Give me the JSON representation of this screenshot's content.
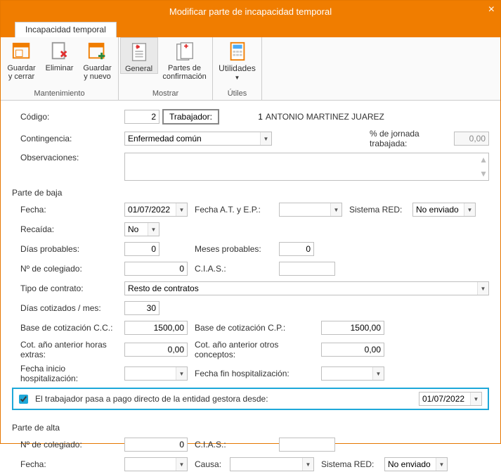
{
  "window": {
    "title": "Modificar parte de incapacidad temporal",
    "close": "×"
  },
  "tabs": {
    "main": "Incapacidad temporal"
  },
  "ribbon": {
    "maintenance_label": "Mantenimiento",
    "show_label": "Mostrar",
    "utils_label": "Útiles",
    "save_close": "Guardar y cerrar",
    "delete": "Eliminar",
    "save_new": "Guardar y nuevo",
    "general": "General",
    "confirm_parts": "Partes de confirmación",
    "utilities": "Utilidades"
  },
  "header": {
    "code_label": "Código:",
    "code_value": "2",
    "worker_btn": "Trabajador:",
    "worker_code": "1",
    "worker_name": "ANTONIO MARTINEZ JUAREZ",
    "contingency_label": "Contingencia:",
    "contingency_value": "Enfermedad común",
    "pct_label": "% de jornada trabajada:",
    "pct_value": "0,00",
    "obs_label": "Observaciones:"
  },
  "baja": {
    "section": "Parte de baja",
    "fecha_label": "Fecha:",
    "fecha": "01/07/2022",
    "fecha_at_label": "Fecha A.T. y E.P.:",
    "fecha_at": "",
    "sred_label": "Sistema RED:",
    "sred": "No enviado",
    "recaida_label": "Recaída:",
    "recaida": "No",
    "dias_prob_label": "Días probables:",
    "dias_prob": "0",
    "meses_prob_label": "Meses probables:",
    "meses_prob": "0",
    "ncol_label": "Nº de colegiado:",
    "ncol": "0",
    "cias_label": "C.I.A.S.:",
    "cias": "",
    "tipo_contrato_label": "Tipo de contrato:",
    "tipo_contrato": "Resto de contratos",
    "dias_cot_label": "Días cotizados / mes:",
    "dias_cot": "30",
    "base_cc_label": "Base de cotización C.C.:",
    "base_cc": "1500,00",
    "base_cp_label": "Base de cotización C.P.:",
    "base_cp": "1500,00",
    "cot_he_label": "Cot. año anterior horas extras:",
    "cot_he": "0,00",
    "cot_oc_label": "Cot. año anterior otros conceptos:",
    "cot_oc": "0,00",
    "hosp_ini_label": "Fecha inicio hospitalización:",
    "hosp_ini": "",
    "hosp_fin_label": "Fecha fin hospitalización:",
    "hosp_fin": "",
    "pago_directo_label": "El trabajador pasa a pago directo de la entidad gestora desde:",
    "pago_directo_fecha": "01/07/2022"
  },
  "alta": {
    "section": "Parte de alta",
    "ncol_label": "Nº de colegiado:",
    "ncol": "0",
    "cias_label": "C.I.A.S.:",
    "cias": "",
    "fecha_label": "Fecha:",
    "fecha": "",
    "causa_label": "Causa:",
    "causa": "",
    "sred_label": "Sistema RED:",
    "sred": "No enviado"
  }
}
